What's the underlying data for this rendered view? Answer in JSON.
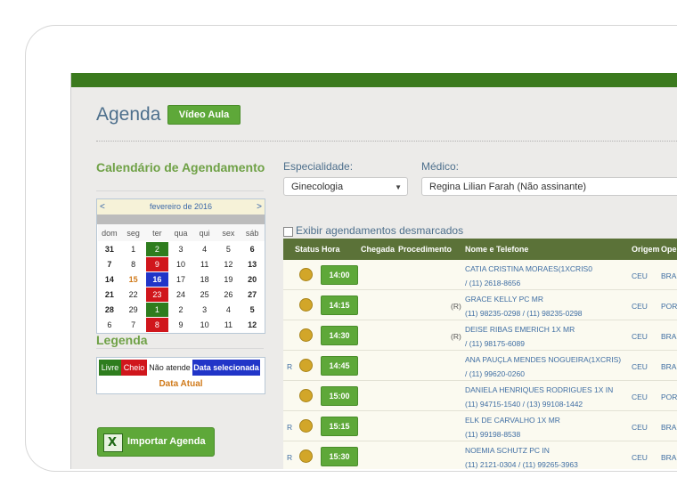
{
  "header": {
    "title": "Agenda",
    "video_button": "Vídeo Aula"
  },
  "calendar": {
    "title": "Calendário de Agendamento",
    "month_label": "fevereiro de 2016",
    "prev": "<",
    "next": ">",
    "weekdays": [
      "dom",
      "seg",
      "ter",
      "qua",
      "qui",
      "sex",
      "sáb"
    ],
    "weeks": [
      [
        "31",
        "1",
        "2",
        "3",
        "4",
        "5",
        "6"
      ],
      [
        "7",
        "8",
        "9",
        "10",
        "11",
        "12",
        "13"
      ],
      [
        "14",
        "15",
        "16",
        "17",
        "18",
        "19",
        "20"
      ],
      [
        "21",
        "22",
        "23",
        "24",
        "25",
        "26",
        "27"
      ],
      [
        "28",
        "29",
        "1",
        "2",
        "3",
        "4",
        "5"
      ],
      [
        "6",
        "7",
        "8",
        "9",
        "10",
        "11",
        "12"
      ]
    ],
    "colors": {
      "livre": "#2e7d1e",
      "cheio": "#d0161c",
      "selecionada": "#2135c8",
      "atual": "#d07a1a"
    }
  },
  "legend": {
    "title": "Legenda",
    "livre": "Livre",
    "cheio": "Cheio",
    "nao_atende": "Não atende",
    "selecionada": "Data selecionada",
    "atual": "Data Atual"
  },
  "import_button": {
    "label": "Importar Agenda",
    "icon": "excel-icon"
  },
  "filters": {
    "especialidade_label": "Especialidade:",
    "especialidade_value": "Ginecologia",
    "medico_label": "Médico:",
    "medico_value": "Regina Lilian Farah (Não assinante)",
    "desmarcados_label": "Exibir agendamentos desmarcados"
  },
  "table": {
    "headers": {
      "status": "Status",
      "hora": "Hora",
      "chegada": "Chegada",
      "procedimento": "Procedimento",
      "nome": "Nome e Telefone",
      "origem": "Origem",
      "operadora": "Oper"
    },
    "rows": [
      {
        "flag": "",
        "time": "14:00",
        "mark": "",
        "name": "CATIA CRISTINA MORAES(1XCRIS0",
        "phone": "/ (11) 2618-8656",
        "origem": "CEU",
        "oper": "BRA"
      },
      {
        "flag": "",
        "time": "14:15",
        "mark": "(R)",
        "name": "GRACE KELLY PC MR",
        "phone": "(11) 98235-0298 / (11) 98235-0298",
        "origem": "CEU",
        "oper": "POR"
      },
      {
        "flag": "",
        "time": "14:30",
        "mark": "(R)",
        "name": "DEISE RIBAS EMERICH 1X MR",
        "phone": "/ (11) 98175-6089",
        "origem": "CEU",
        "oper": "BRA"
      },
      {
        "flag": "R",
        "time": "14:45",
        "mark": "",
        "name": "ANA PAUÇLA MENDES NOGUEIRA(1XCRIS)",
        "phone": "/ (11) 99620-0260",
        "origem": "CEU",
        "oper": "BRA"
      },
      {
        "flag": "",
        "time": "15:00",
        "mark": "",
        "name": "DANIELA HENRIQUES RODRIGUES 1X IN",
        "phone": "(11) 94715-1540 / (13) 99108-1442",
        "origem": "CEU",
        "oper": "POR"
      },
      {
        "flag": "R",
        "time": "15:15",
        "mark": "",
        "name": "ELK DE CARVALHO 1X MR",
        "phone": "(11) 99198-8538",
        "origem": "CEU",
        "oper": "BRA"
      },
      {
        "flag": "R",
        "time": "15:30",
        "mark": "",
        "name": "NOEMIA SCHUTZ PC IN",
        "phone": "(11) 2121-0304 / (11) 99265-3963",
        "origem": "CEU",
        "oper": "BRA"
      }
    ]
  }
}
